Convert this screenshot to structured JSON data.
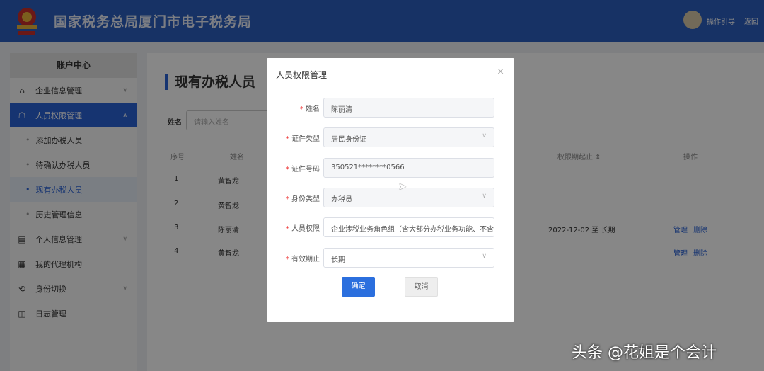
{
  "header": {
    "title": "国家税务总局厦门市电子税务局",
    "guide": "操作引导",
    "back": "返回"
  },
  "sidebar": {
    "title": "账户中心",
    "items": [
      {
        "label": "企业信息管理",
        "icon": "building-icon"
      },
      {
        "label": "人员权限管理",
        "icon": "user-lock-icon"
      },
      {
        "label": "个人信息管理",
        "icon": "profile-icon"
      },
      {
        "label": "我的代理机构",
        "icon": "agency-icon"
      },
      {
        "label": "身份切换",
        "icon": "switch-icon"
      },
      {
        "label": "日志管理",
        "icon": "log-icon"
      }
    ],
    "subitems": [
      "添加办税人员",
      "待确认办税人员",
      "现有办税人员",
      "历史管理信息"
    ]
  },
  "main": {
    "title": "现有办税人员",
    "search_label": "姓名",
    "search_placeholder": "请输入姓名",
    "columns": [
      "序号",
      "姓名",
      "权限期起止 ⇕",
      "操作"
    ],
    "rows": [
      {
        "no": "1",
        "name": "黄智龙",
        "period": "",
        "actions": []
      },
      {
        "no": "2",
        "name": "黄智龙",
        "period": "",
        "actions": []
      },
      {
        "no": "3",
        "name": "陈丽清",
        "period": "2022-12-02 至 长期",
        "actions": [
          "管理",
          "删除"
        ]
      },
      {
        "no": "4",
        "name": "黄智龙",
        "period": "",
        "actions": [
          "管理",
          "删除"
        ]
      }
    ]
  },
  "modal": {
    "title": "人员权限管理",
    "fields": [
      {
        "label": "姓名",
        "value": "陈丽清"
      },
      {
        "label": "证件类型",
        "value": "居民身份证"
      },
      {
        "label": "证件号码",
        "value": "350521********0566"
      },
      {
        "label": "身份类型",
        "value": "办税员"
      },
      {
        "label": "人员权限",
        "value": "企业涉税业务角色组（含大部分办税业务功能、不含"
      },
      {
        "label": "有效期止",
        "value": "长期"
      }
    ],
    "confirm": "确定",
    "cancel": "取消"
  },
  "watermark": "头条 @花姐是个会计"
}
